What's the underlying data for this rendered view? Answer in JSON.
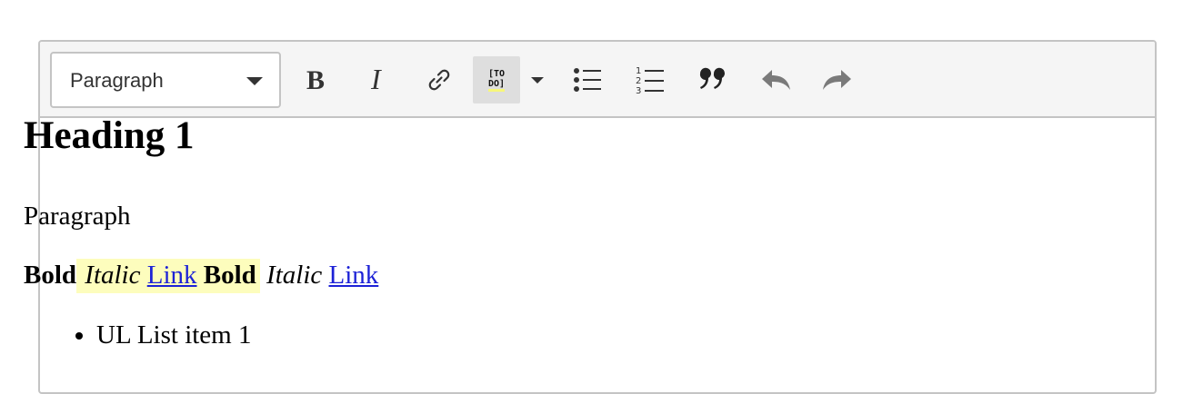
{
  "toolbar": {
    "heading_select": {
      "value": "Paragraph"
    },
    "buttons": [
      {
        "name": "bold",
        "icon": "bold-icon"
      },
      {
        "name": "italic",
        "icon": "italic-icon"
      },
      {
        "name": "link",
        "icon": "link-icon"
      },
      {
        "name": "todo-highlight",
        "icon": "todo-highlight-icon",
        "icon_text_line1": "[TO",
        "icon_text_line2": "DO]",
        "active": true
      },
      {
        "name": "bulleted-list",
        "icon": "bulleted-list-icon"
      },
      {
        "name": "numbered-list",
        "icon": "numbered-list-icon"
      },
      {
        "name": "block-quote",
        "icon": "quote-icon"
      },
      {
        "name": "undo",
        "icon": "undo-icon"
      },
      {
        "name": "redo",
        "icon": "redo-icon"
      }
    ]
  },
  "content": {
    "heading": "Heading 1",
    "paragraph": "Paragraph",
    "formatted_line": {
      "bold1": "Bold",
      "italic1": "Italic",
      "link1": "Link",
      "bold2": "Bold",
      "italic2": "Italic",
      "link2": "Link"
    },
    "list_items": [
      "UL List item 1"
    ]
  },
  "colors": {
    "toolbar_bg": "#f5f5f5",
    "border": "#c4c4c4",
    "highlight_yellow": "#fdfdbd",
    "link": "#1d22d6",
    "active_button": "#dedede"
  }
}
